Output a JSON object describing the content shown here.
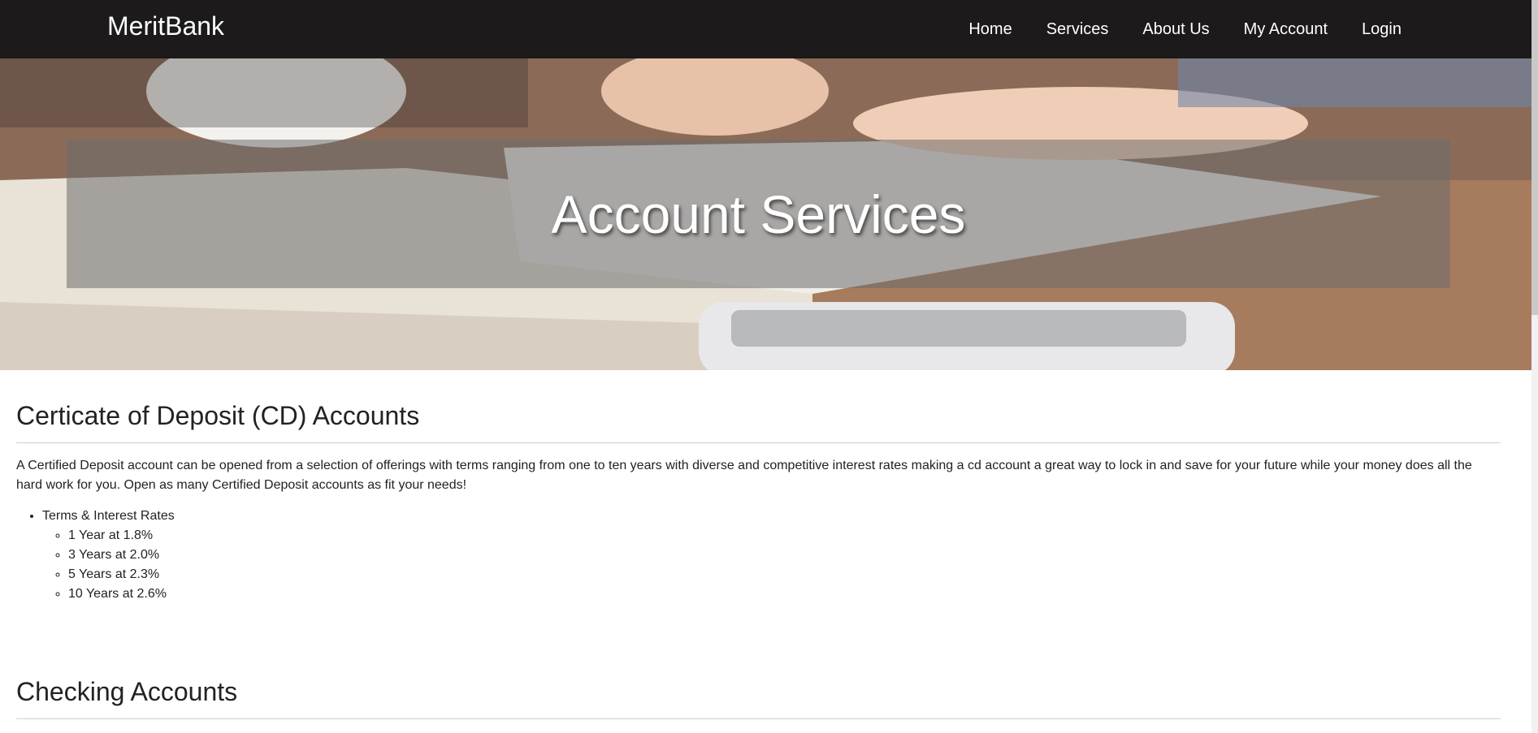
{
  "nav": {
    "brand": "MeritBank",
    "links": [
      "Home",
      "Services",
      "About Us",
      "My Account",
      "Login"
    ]
  },
  "hero": {
    "title": "Account Services"
  },
  "sections": [
    {
      "title": "Certicate of Deposit (CD) Accounts",
      "text": "A Certified Deposit account can be opened from a selection of offerings with terms ranging from one to ten years with diverse and competitive interest rates making a cd account a great way to lock in and save for your future while your money does all the hard work for you. Open as many Certified Deposit accounts as fit your needs!",
      "list_heading": "Terms & Interest Rates",
      "rates": [
        "1 Year at 1.8%",
        "3 Years at 2.0%",
        "5 Years at 2.3%",
        "10 Years at 2.6%"
      ]
    },
    {
      "title": "Checking Accounts"
    }
  ]
}
